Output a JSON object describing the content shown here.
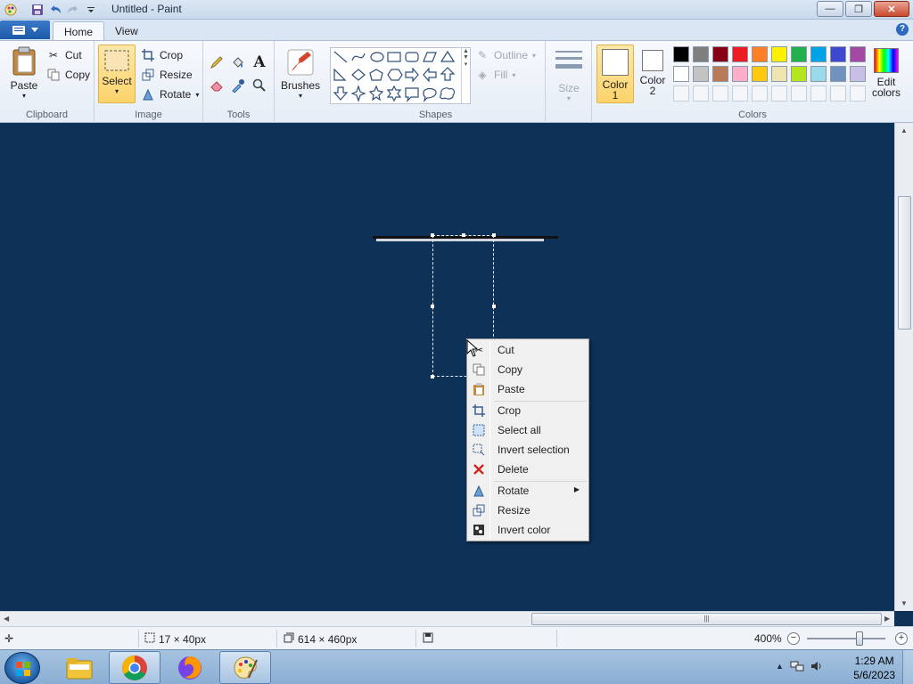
{
  "window": {
    "title": "Untitled - Paint",
    "minimize_symbol": "—",
    "maximize_symbol": "❐",
    "close_symbol": "✕"
  },
  "ribbon_tabs": {
    "home": "Home",
    "view": "View"
  },
  "clipboard": {
    "paste": "Paste",
    "cut": "Cut",
    "copy": "Copy",
    "group_label": "Clipboard"
  },
  "image": {
    "select": "Select",
    "crop": "Crop",
    "resize": "Resize",
    "rotate": "Rotate",
    "group_label": "Image"
  },
  "tools": {
    "group_label": "Tools",
    "text_glyph": "A"
  },
  "brushes": {
    "label": "Brushes"
  },
  "shapes": {
    "outline": "Outline",
    "fill": "Fill",
    "group_label": "Shapes"
  },
  "size": {
    "label": "Size"
  },
  "colors": {
    "color1_line1": "Color",
    "color1_line2": "1",
    "color2_line1": "Color",
    "color2_line2": "2",
    "edit_line1": "Edit",
    "edit_line2": "colors",
    "group_label": "Colors",
    "color1_value": "#ffffff",
    "color2_value": "#ffffff",
    "row1": [
      "#000000",
      "#7f7f7f",
      "#880015",
      "#ed1c24",
      "#ff7f27",
      "#fff200",
      "#22b14c",
      "#00a2e8",
      "#3f48cc",
      "#a349a4"
    ],
    "row2": [
      "#ffffff",
      "#c3c3c3",
      "#b97a57",
      "#ffaec9",
      "#ffc90e",
      "#efe4b0",
      "#b5e61d",
      "#99d9ea",
      "#7092be",
      "#c8bfe7"
    ]
  },
  "canvas": {
    "background": "#0e3158"
  },
  "context_menu": {
    "items": [
      {
        "label": "Cut"
      },
      {
        "label": "Copy"
      },
      {
        "label": "Paste"
      },
      {
        "label": "Crop"
      },
      {
        "label": "Select all"
      },
      {
        "label": "Invert selection"
      },
      {
        "label": "Delete"
      },
      {
        "label": "Rotate"
      },
      {
        "label": "Resize"
      },
      {
        "label": "Invert color"
      }
    ]
  },
  "statusbar": {
    "selection_size": "17 × 40px",
    "image_size": "614 × 460px",
    "zoom": "400%"
  },
  "taskbar": {
    "time": "1:29 AM",
    "date": "5/6/2023"
  }
}
